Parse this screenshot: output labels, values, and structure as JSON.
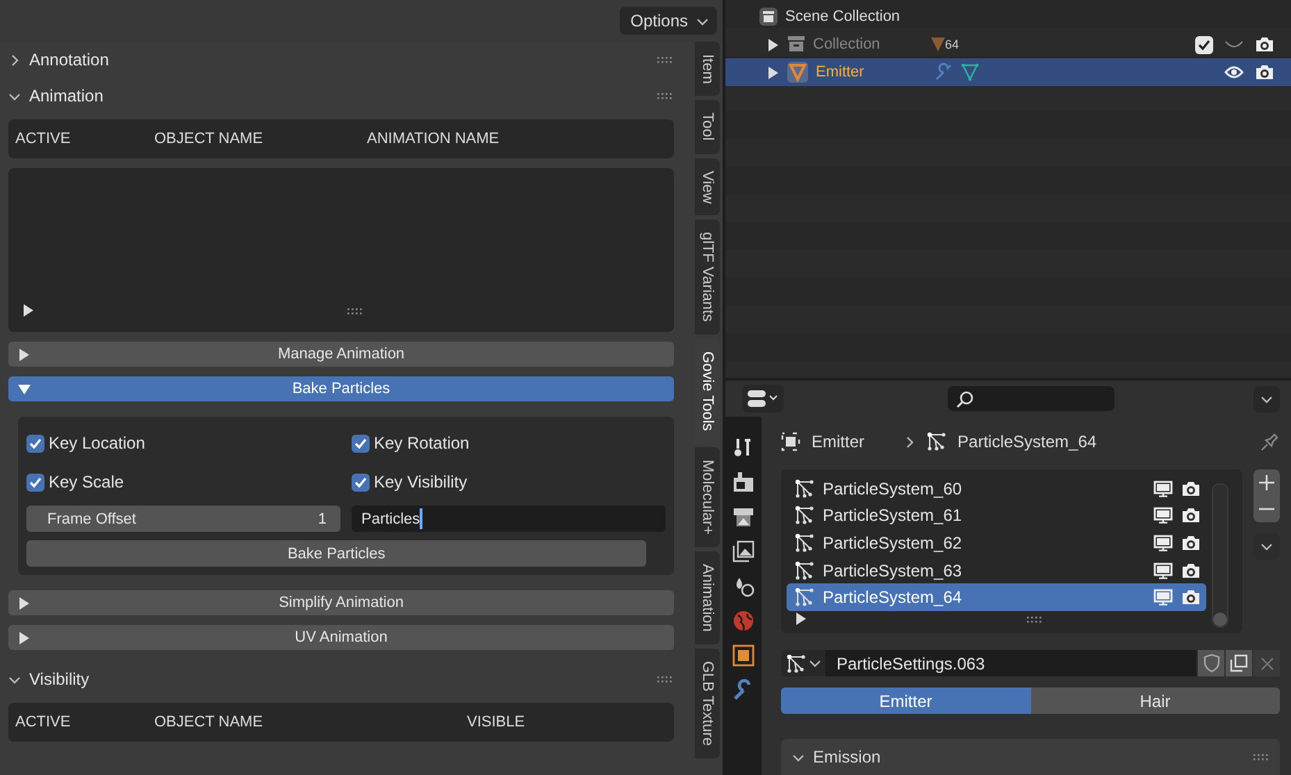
{
  "viewport": {
    "options_button": "Options"
  },
  "panels": [
    {
      "title": "Annotation",
      "expanded": false
    },
    {
      "title": "Animation",
      "expanded": true,
      "columns": [
        "ACTIVE",
        "OBJECT NAME",
        "ANIMATION NAME"
      ],
      "subpanels": [
        {
          "title": "Manage Animation",
          "expanded": false
        },
        {
          "title": "Bake Particles",
          "expanded": true,
          "checkboxes": [
            {
              "label": "Key Location",
              "checked": true
            },
            {
              "label": "Key Rotation",
              "checked": true
            },
            {
              "label": "Key Scale",
              "checked": true
            },
            {
              "label": "Key Visibility",
              "checked": true
            }
          ],
          "frame_offset": {
            "label": "Frame Offset",
            "value": "1"
          },
          "name_field": {
            "value": "Particles"
          },
          "button": "Bake Particles"
        },
        {
          "title": "Simplify Animation",
          "expanded": false
        },
        {
          "title": "UV Animation",
          "expanded": false
        }
      ]
    },
    {
      "title": "Visibility",
      "expanded": true,
      "columns": [
        "ACTIVE",
        "OBJECT NAME",
        "VISIBLE"
      ]
    }
  ],
  "tabs": [
    {
      "label": "Item",
      "selected": false
    },
    {
      "label": "Tool",
      "selected": false
    },
    {
      "label": "View",
      "selected": false
    },
    {
      "label": "glTF Variants",
      "selected": false
    },
    {
      "label": "Govie Tools",
      "selected": true
    },
    {
      "label": "Molecular+",
      "selected": false
    },
    {
      "label": "Animation",
      "selected": false
    },
    {
      "label": "GLB Texture",
      "selected": false
    }
  ],
  "outliner": {
    "root": "Scene Collection",
    "items": [
      {
        "name": "Collection",
        "kind": "collection",
        "selected": false,
        "hidden": true,
        "checked": true,
        "badge": "64"
      },
      {
        "name": "Emitter",
        "kind": "object",
        "selected": true,
        "hidden": false
      }
    ]
  },
  "properties": {
    "breadcrumb": [
      "Emitter",
      "ParticleSystem_64"
    ],
    "particle_systems": [
      {
        "name": "ParticleSystem_60",
        "selected": false
      },
      {
        "name": "ParticleSystem_61",
        "selected": false
      },
      {
        "name": "ParticleSystem_62",
        "selected": false
      },
      {
        "name": "ParticleSystem_63",
        "selected": false
      },
      {
        "name": "ParticleSystem_64",
        "selected": true
      }
    ],
    "settings": "ParticleSettings.063",
    "types": [
      {
        "label": "Emitter",
        "selected": true
      },
      {
        "label": "Hair",
        "selected": false
      }
    ],
    "section": {
      "title": "Emission",
      "expanded": true
    }
  }
}
